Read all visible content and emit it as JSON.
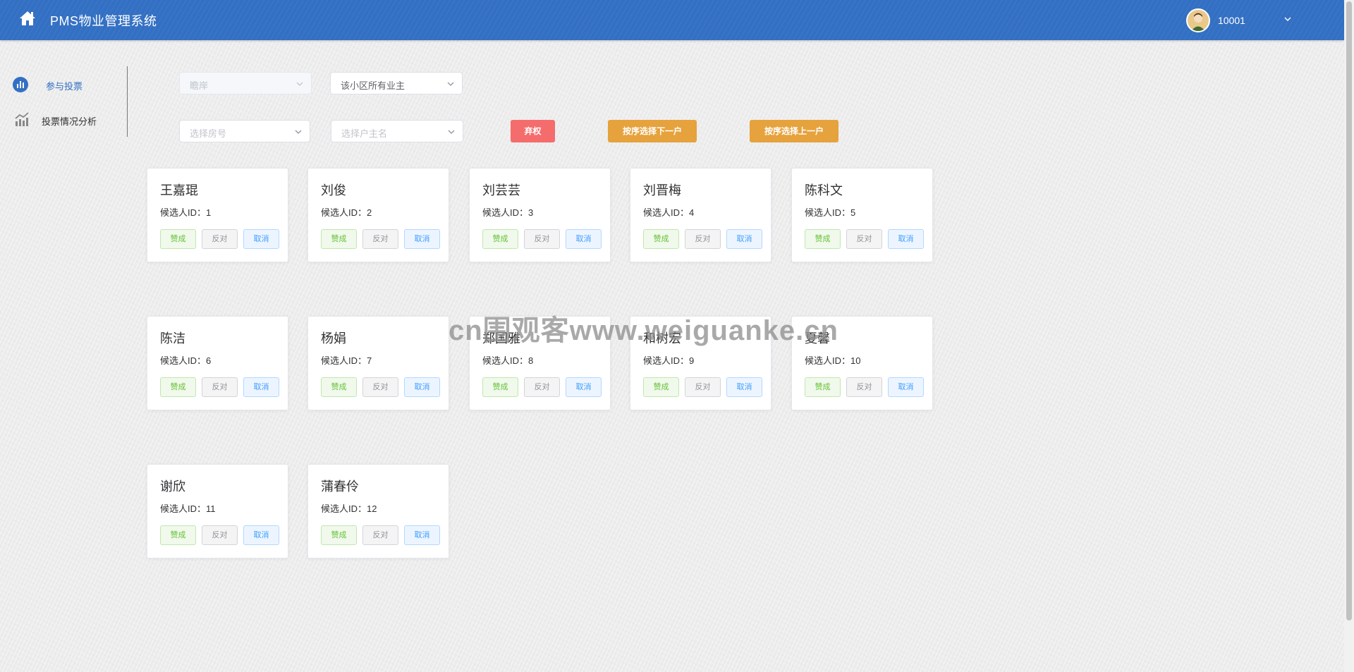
{
  "header": {
    "title": "PMS物业管理系统",
    "user_name": "10001",
    "background_color": "#3370c3"
  },
  "sidebar": {
    "items": [
      {
        "label": "参与投票",
        "icon": "bar-chart-icon",
        "active": true
      },
      {
        "label": "投票情况分析",
        "icon": "trend-chart-icon",
        "active": false
      }
    ]
  },
  "filters": {
    "building_select_placeholder": "瞻岸",
    "scope_select_value": "该小区所有业主",
    "room_select_placeholder": "选择房号",
    "owner_select_placeholder": "选择户主名"
  },
  "actions": {
    "abstain_label": "弃权",
    "next_label": "按序选择下一户",
    "prev_label": "按序选择上一户"
  },
  "candidate_id_prefix": "候选人ID：",
  "vote_buttons": {
    "agree": "赞成",
    "oppose": "反对",
    "cancel": "取消"
  },
  "candidates": [
    {
      "name": "王嘉琨",
      "id_text": "候选人ID：1"
    },
    {
      "name": "刘俊",
      "id_text": "候选人ID：2"
    },
    {
      "name": "刘芸芸",
      "id_text": "候选人ID：3"
    },
    {
      "name": "刘晋梅",
      "id_text": "候选人ID：4"
    },
    {
      "name": "陈科文",
      "id_text": "候选人ID：5"
    },
    {
      "name": "陈洁",
      "id_text": "候选人ID：6"
    },
    {
      "name": "杨娟",
      "id_text": "候选人ID：7"
    },
    {
      "name": "郑国雅",
      "id_text": "候选人ID：8"
    },
    {
      "name": "和树宏",
      "id_text": "候选人ID：9"
    },
    {
      "name": "夏馨",
      "id_text": "候选人ID：10"
    },
    {
      "name": "谢欣",
      "id_text": "候选人ID：11"
    },
    {
      "name": "蒲春伶",
      "id_text": "候选人ID：12"
    }
  ],
  "watermark": "cn围观客www.weiguanke.cn"
}
